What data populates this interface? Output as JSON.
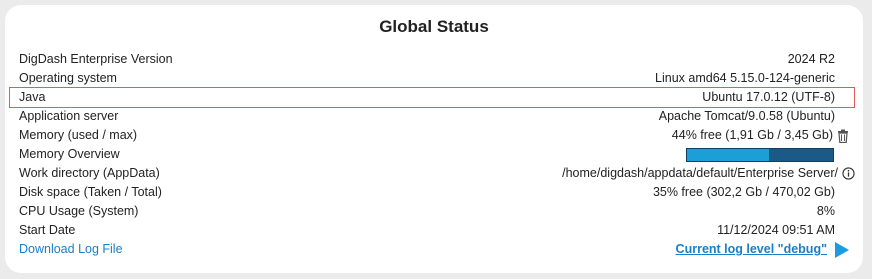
{
  "panel": {
    "title": "Global Status"
  },
  "rows": [
    {
      "label": "DigDash Enterprise Version",
      "value": "2024 R2"
    },
    {
      "label": "Operating system",
      "value": "Linux amd64 5.15.0-124-generic"
    },
    {
      "label": "Java",
      "value": "Ubuntu 17.0.12 (UTF-8)"
    },
    {
      "label": "Application server",
      "value": "Apache Tomcat/9.0.58 (Ubuntu)"
    },
    {
      "label": "Memory (used / max)",
      "value": "44% free (1,91 Gb / 3,45 Gb)"
    },
    {
      "label": "Memory Overview"
    },
    {
      "label": "Work directory (AppData)",
      "value": "/home/digdash/appdata/default/Enterprise Server/"
    },
    {
      "label": "Disk space (Taken / Total)",
      "value": "35% free (302,2 Gb / 470,02 Gb)"
    },
    {
      "label": "CPU Usage (System)",
      "value": "8%"
    },
    {
      "label": "Start Date",
      "value": "11/12/2024 09:51 AM"
    }
  ],
  "memory_overview": {
    "used_fraction": 0.56
  },
  "footer": {
    "download_link": "Download Log File",
    "log_level_link": "Current log level \"debug\""
  },
  "colors": {
    "highlight_border": "#e05a5a",
    "link": "#1a7fc8",
    "bar_used": "#1c9ed6",
    "bar_free": "#1b5a86"
  },
  "icons": {
    "memory_action": "trash-icon",
    "work_directory_action": "info-icon",
    "log_level_action": "play-icon"
  }
}
